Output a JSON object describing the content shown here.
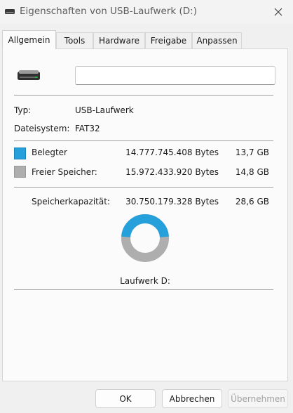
{
  "window": {
    "title": "Eigenschaften von USB-Laufwerk (D:)",
    "icon": "usb-drive-icon",
    "close_icon": "close-icon"
  },
  "tabs": [
    {
      "label": "Allgemein",
      "active": true
    },
    {
      "label": "Tools",
      "active": false
    },
    {
      "label": "Hardware",
      "active": false
    },
    {
      "label": "Freigabe",
      "active": false
    },
    {
      "label": "Anpassen",
      "active": false
    }
  ],
  "general": {
    "drive_icon": "usb-drive-icon",
    "name_value": "",
    "type_label": "Typ:",
    "type_value": "USB-Laufwerk",
    "filesystem_label": "Dateisystem:",
    "filesystem_value": "FAT32",
    "used": {
      "label": "Belegter",
      "bytes": "14.777.745.408 Bytes",
      "gb": "13,7 GB",
      "color": "#26a0da"
    },
    "free": {
      "label": "Freier Speicher:",
      "bytes": "15.972.433.920 Bytes",
      "gb": "14,8 GB",
      "color": "#aeaeae"
    },
    "capacity": {
      "label": "Speicherkapazität:",
      "bytes": "30.750.179.328 Bytes",
      "gb": "28,6 GB"
    },
    "drive_label": "Laufwerk D:",
    "used_fraction": 0.4806
  },
  "buttons": {
    "ok": "OK",
    "cancel": "Abbrechen",
    "apply": "Übernehmen"
  }
}
